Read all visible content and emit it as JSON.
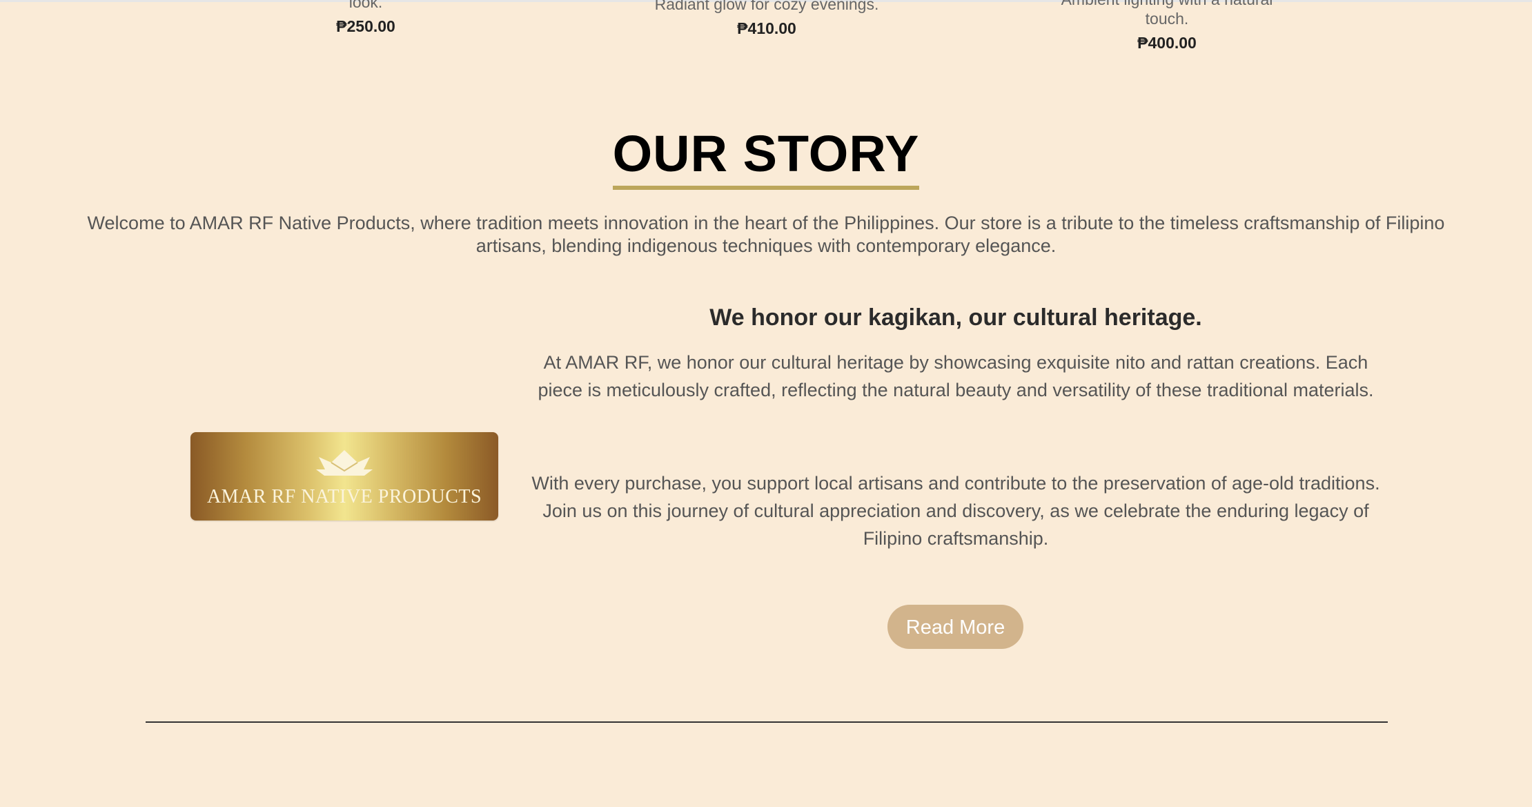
{
  "products": [
    {
      "desc": "look.",
      "price": "₱250.00"
    },
    {
      "desc": "Radiant glow for cozy evenings.",
      "price": "₱410.00"
    },
    {
      "desc_line1": "Ambient lighting with a natural",
      "desc_line2": "touch.",
      "price": "₱400.00"
    }
  ],
  "story": {
    "title": "OUR STORY",
    "intro": "Welcome to AMAR RF Native Products, where tradition meets innovation in the heart of the Philippines. Our store is a tribute to the timeless craftsmanship of Filipino artisans, blending indigenous techniques with contemporary elegance.",
    "logo_text": "AMAR RF NATIVE PRODUCTS",
    "heritage_title": "We honor our kagikan, our cultural heritage.",
    "paragraph1": "At AMAR RF, we honor our cultural heritage by showcasing exquisite nito and rattan creations. Each piece is meticulously crafted, reflecting the natural beauty and versatility of these traditional materials.",
    "paragraph2": "With every purchase, you support local artisans and contribute to the preservation of age-old traditions. Join us on this journey of cultural appreciation and discovery, as we celebrate the enduring legacy of Filipino craftsmanship.",
    "read_more": "Read More"
  },
  "colors": {
    "background": "#faebd7",
    "accent_underline": "#bca65b",
    "button": "#d2b48c"
  },
  "icons": {
    "logo_mark": "crown-boat-icon"
  }
}
